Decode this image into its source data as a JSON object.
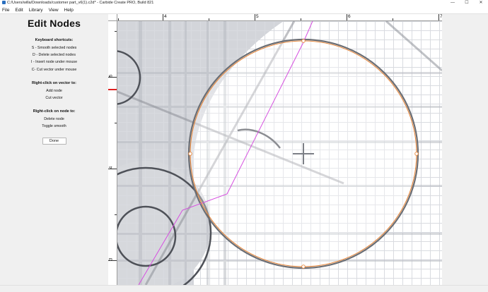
{
  "window": {
    "title": "C:/Users/willa/Downloads/customer part_v6(1).c2d* - Carbide Create PRO, Build 821",
    "controls": {
      "minimize": "—",
      "maximize": "☐",
      "close": "✕"
    }
  },
  "menu": [
    "File",
    "Edit",
    "Library",
    "View",
    "Help"
  ],
  "panel": {
    "title": "Edit Nodes",
    "keyboard": {
      "heading": "Keyboard shortcuts:",
      "lines": [
        "S - Smooth selected nodes",
        "D - Delete selected nodes",
        "I - Insert node under mouse",
        "C- Cut vector under mouse"
      ]
    },
    "vector": {
      "heading": "Right-click on vector to:",
      "lines": [
        "Add node",
        "Cut vector"
      ]
    },
    "node": {
      "heading": "Right-click on node to:",
      "lines": [
        "Delete node",
        "Toggle smooth"
      ]
    },
    "done": "Done"
  },
  "ruler": {
    "top": [
      "4",
      "5",
      "6",
      "7"
    ],
    "left": [
      "5",
      "4",
      "3"
    ]
  },
  "colors": {
    "selected_circle": "#e8893e",
    "toolpath_line": "#d64fe0",
    "vector_outline": "#555555",
    "background_image": "#cfd1d6",
    "ruler_marker": "#e02020"
  },
  "icons": {
    "app": "carbide-create-icon",
    "node_marker": "crosshair-icon"
  }
}
